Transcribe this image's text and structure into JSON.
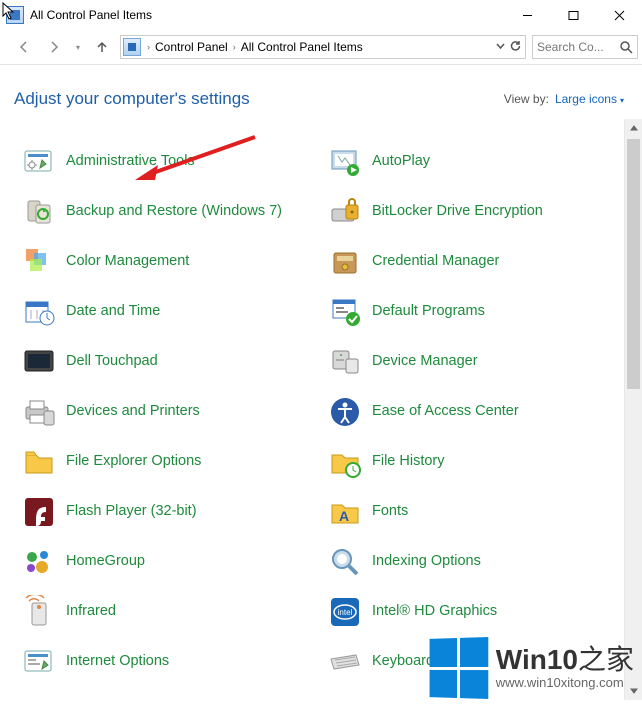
{
  "window": {
    "title": "All Control Panel Items"
  },
  "breadcrumbs": {
    "root_sep": "›",
    "item1": "Control Panel",
    "sep": "›",
    "item2": "All Control Panel Items"
  },
  "search": {
    "placeholder": "Search Co..."
  },
  "header": {
    "adjust": "Adjust your computer's settings",
    "viewby_label": "View by:",
    "viewby_value": "Large icons"
  },
  "items": {
    "left": [
      "Administrative Tools",
      "Backup and Restore (Windows 7)",
      "Color Management",
      "Date and Time",
      "Dell Touchpad",
      "Devices and Printers",
      "File Explorer Options",
      "Flash Player (32-bit)",
      "HomeGroup",
      "Infrared",
      "Internet Options"
    ],
    "right": [
      "AutoPlay",
      "BitLocker Drive Encryption",
      "Credential Manager",
      "Default Programs",
      "Device Manager",
      "Ease of Access Center",
      "File History",
      "Fonts",
      "Indexing Options",
      "Intel® HD Graphics",
      "Keyboard"
    ]
  },
  "watermark": {
    "brand_prefix": "Win10",
    "brand_suffix": "之家",
    "url": "www.win10xitong.com"
  }
}
